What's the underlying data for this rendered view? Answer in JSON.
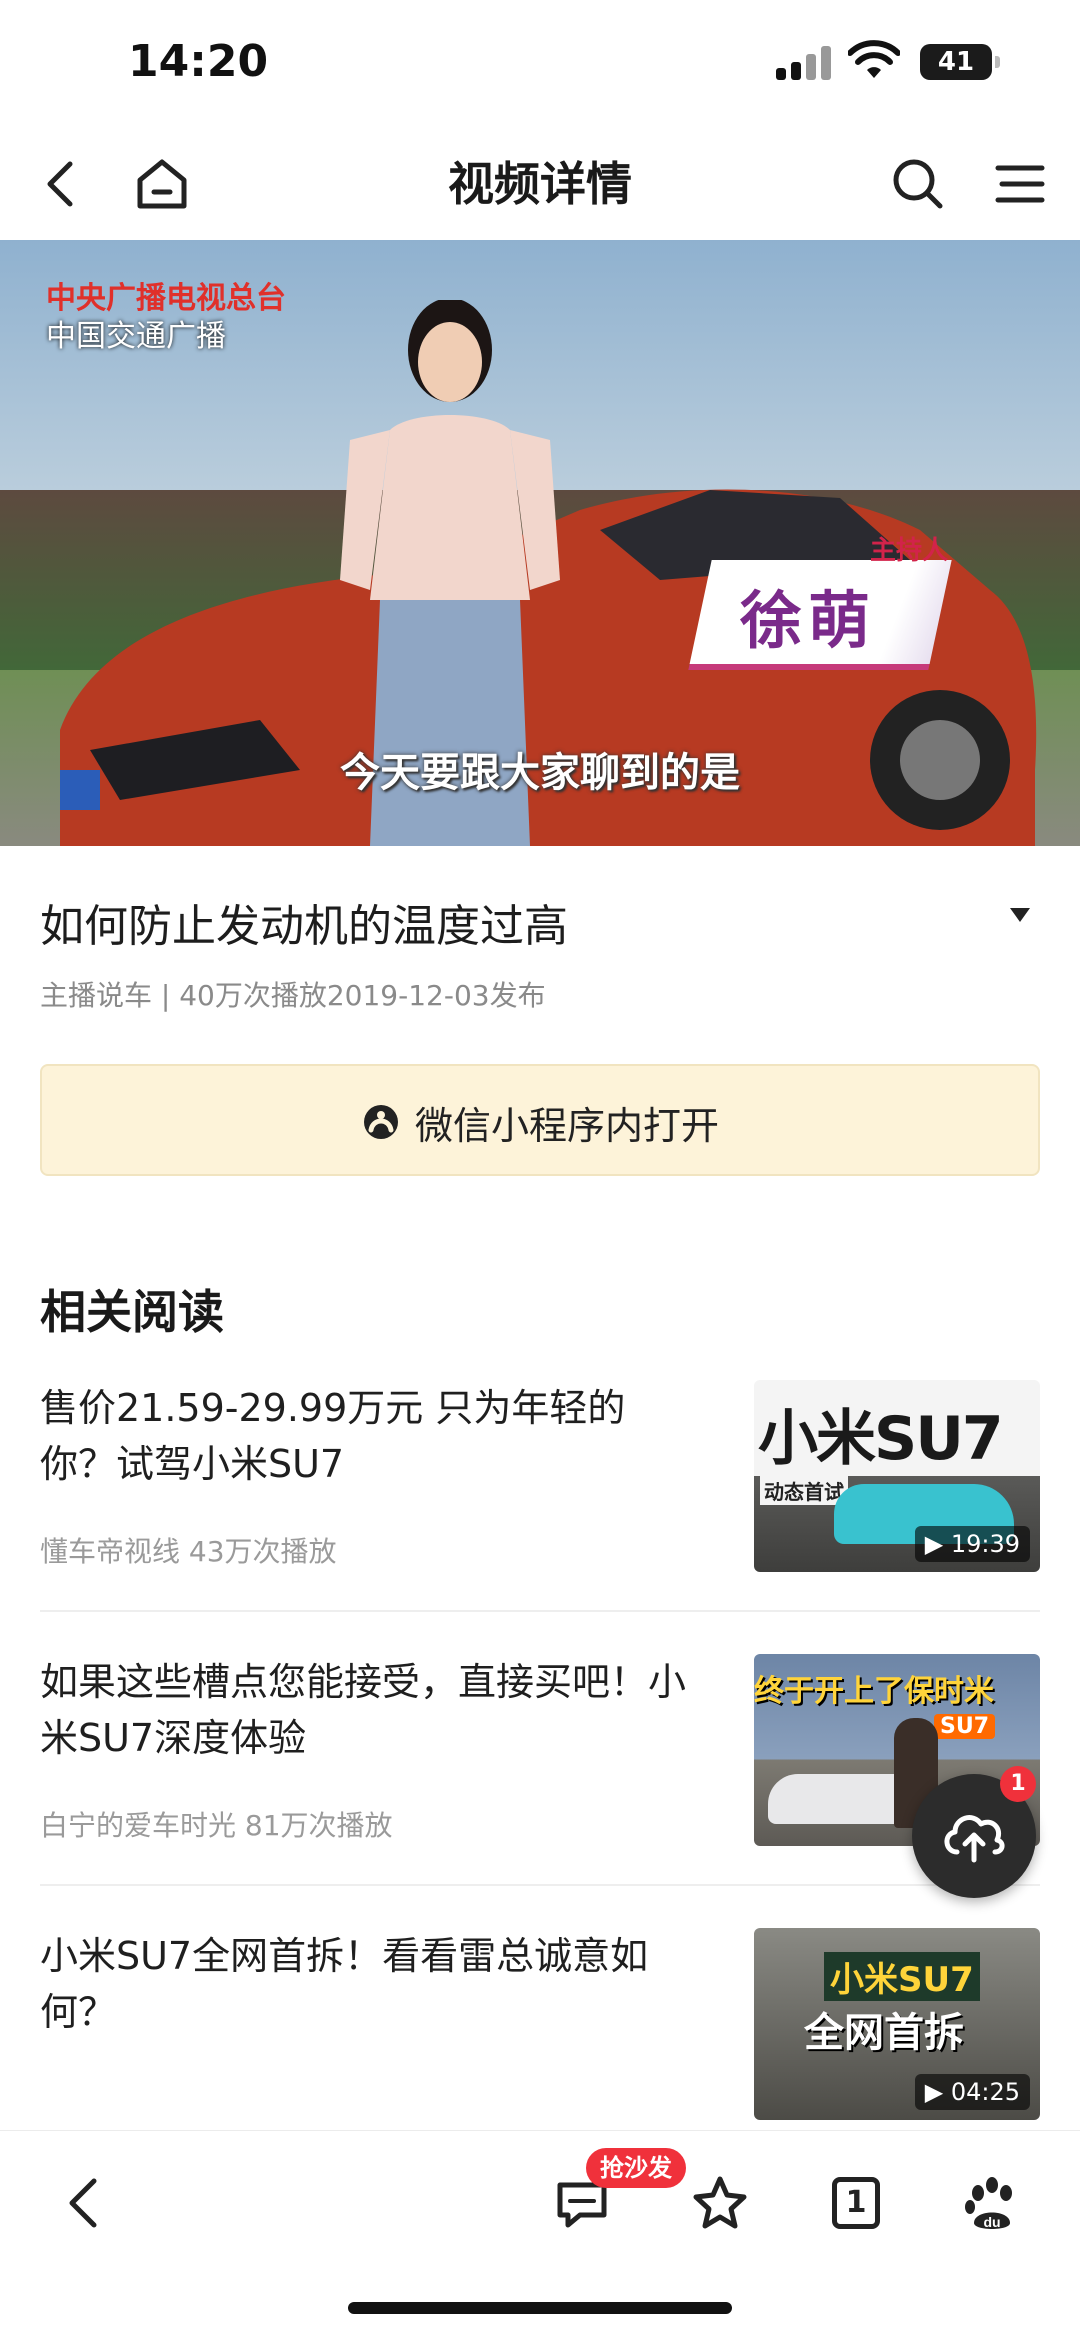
{
  "status": {
    "time": "14:20",
    "battery": "41"
  },
  "nav": {
    "title": "视频详情"
  },
  "video": {
    "broadcaster_line1": "中央广播电视总台",
    "broadcaster_line2": "中国交通广播",
    "host_role": "主持人",
    "host_name": "徐萌",
    "subtitle": "今天要跟大家聊到的是"
  },
  "info": {
    "title": "如何防止发动机的温度过高",
    "meta": "主播说车 | 40万次播放2019-12-03发布"
  },
  "open_button": {
    "label": "微信小程序内打开"
  },
  "related": {
    "title": "相关阅读",
    "items": [
      {
        "title": "售价21.59-29.99万元 只为年轻的你？试驾小米SU7",
        "meta": "懂车帝视线   43万次播放",
        "thumb_text": "小米SU7",
        "thumb_caption": "动态首试",
        "duration": "19:39"
      },
      {
        "title": "如果这些槽点您能接受，直接买吧！小米SU7深度体验",
        "meta": "白宁的爱车时光   81万次播放",
        "thumb_text": "终于开上了保时米",
        "thumb_caption": "SU7",
        "duration": ""
      },
      {
        "title": "小米SU7全网首拆！看看雷总诚意如何？",
        "meta": "",
        "thumb_text": "小米SU7",
        "thumb_caption": "全网首拆",
        "duration": "04:25"
      }
    ]
  },
  "fab": {
    "badge": "1"
  },
  "toolbar": {
    "comment_badge": "抢沙发",
    "tabs_count": "1"
  },
  "colors": {
    "accent_red": "#f0313b",
    "open_button_bg": "#fdf3d9"
  }
}
